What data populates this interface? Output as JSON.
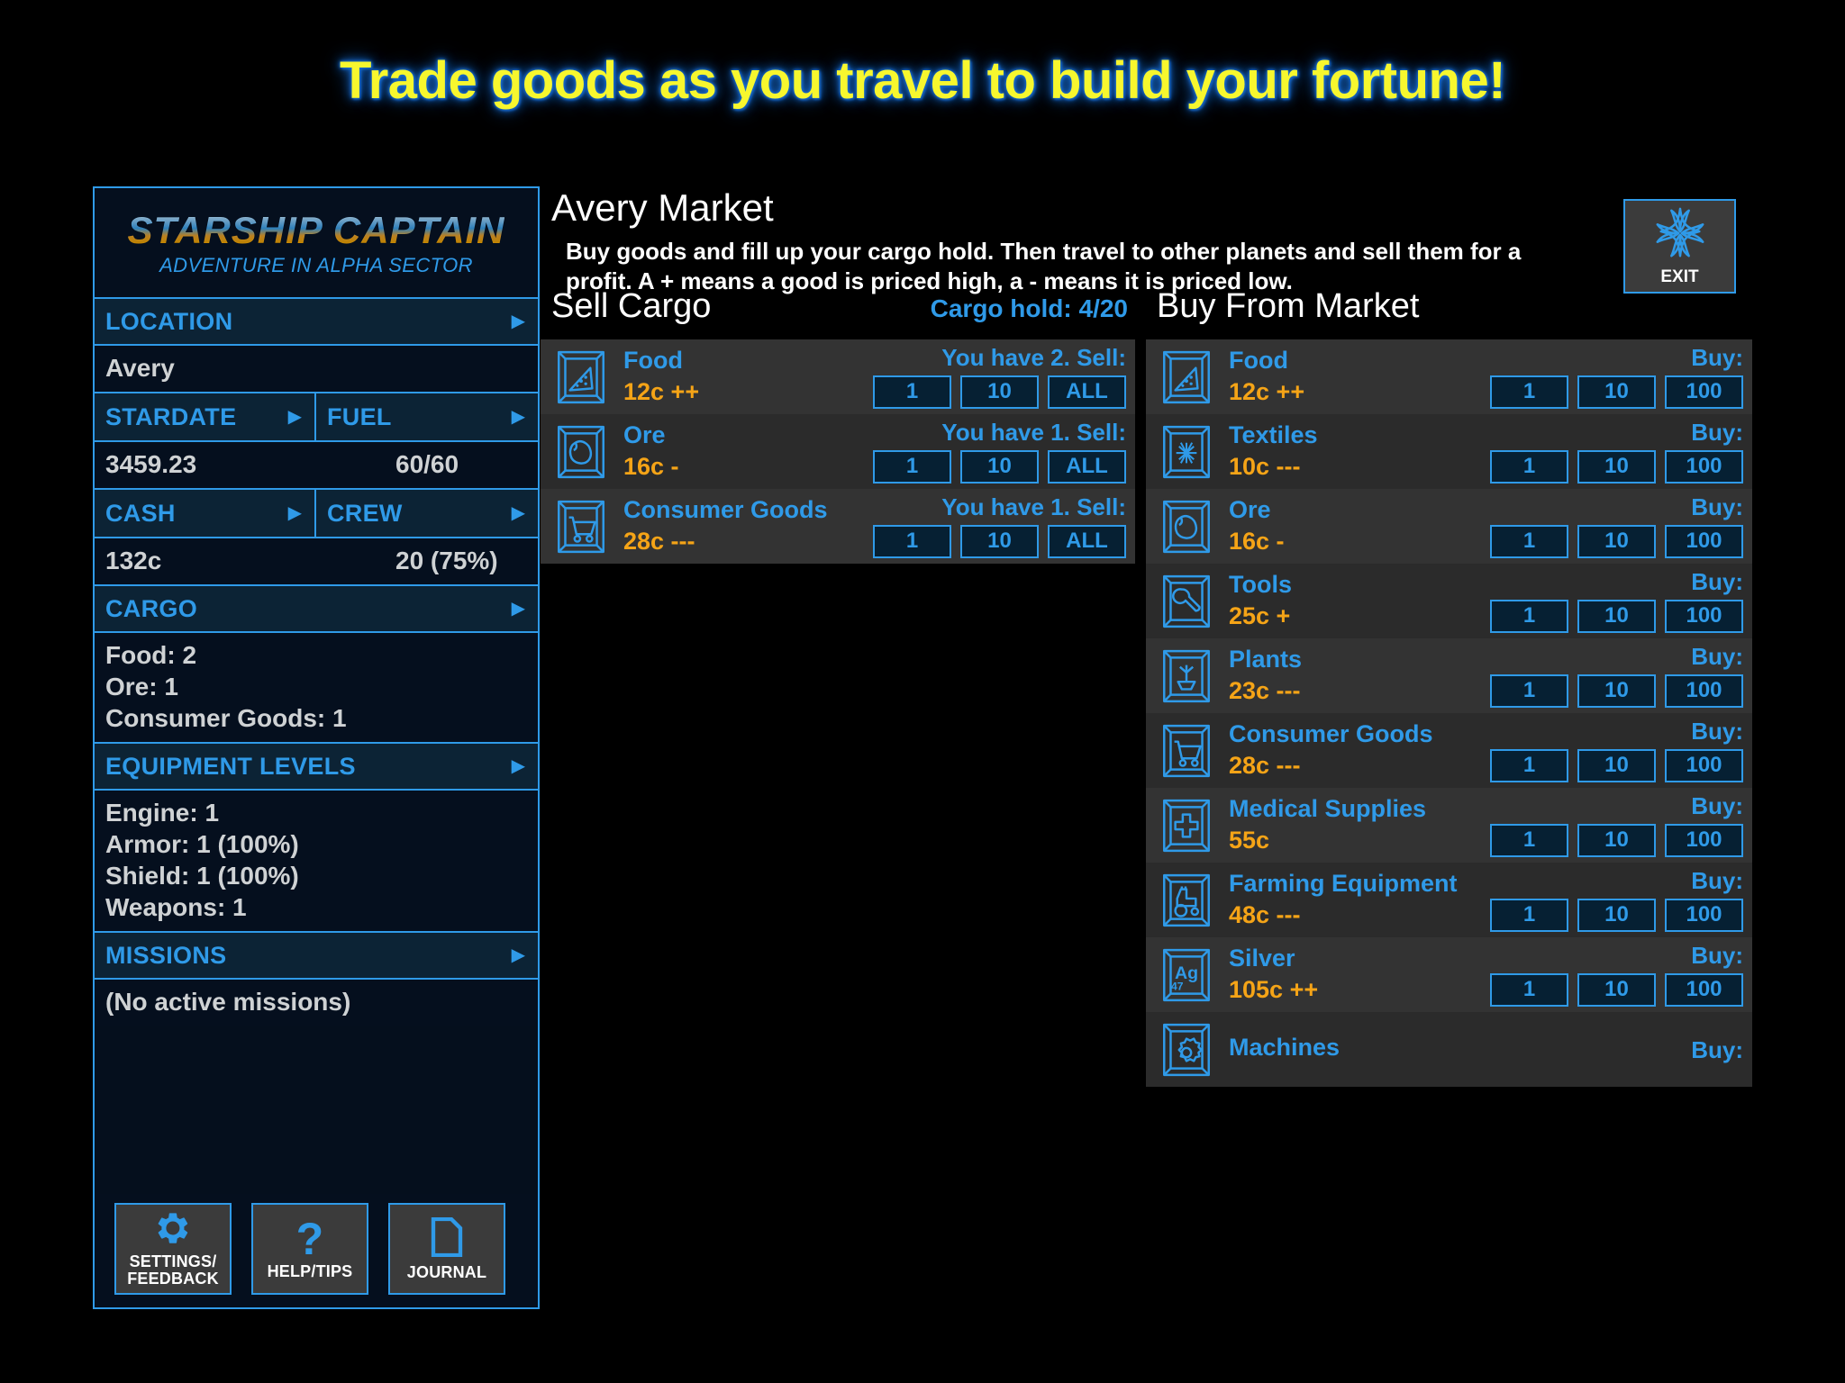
{
  "banner": {
    "text": "Trade goods as you travel to build your fortune!"
  },
  "sidebar": {
    "logo_main": "STARSHIP CAPTAIN",
    "logo_sub": "ADVENTURE IN ALPHA SECTOR",
    "sections": {
      "location_label": "LOCATION",
      "location_value": "Avery",
      "stardate_label": "STARDATE",
      "stardate_value": "3459.23",
      "fuel_label": "FUEL",
      "fuel_value": "60/60",
      "cash_label": "CASH",
      "cash_value": "132c",
      "crew_label": "CREW",
      "crew_value": "20 (75%)",
      "cargo_label": "CARGO",
      "cargo_lines": [
        "Food: 2",
        "Ore: 1",
        "Consumer Goods: 1"
      ],
      "equipment_label": "EQUIPMENT LEVELS",
      "equipment_lines": [
        "Engine: 1",
        "Armor: 1 (100%)",
        "Shield: 1 (100%)",
        "Weapons: 1"
      ],
      "missions_label": "MISSIONS",
      "missions_value": "(No active missions)"
    },
    "buttons": [
      {
        "icon": "gear-icon",
        "label_line1": "SETTINGS/",
        "label_line2": "FEEDBACK"
      },
      {
        "icon": "question-mark-icon",
        "label_line1": "HELP/TIPS",
        "label_line2": ""
      },
      {
        "icon": "journal-page-icon",
        "label_line1": "JOURNAL",
        "label_line2": ""
      }
    ],
    "arrow_glyph": "▶"
  },
  "main": {
    "title": "Avery Market",
    "description": "Buy goods and fill up your cargo hold. Then travel to other planets and sell them for a profit. A + means a good is priced high, a - means it is priced low.",
    "exit": {
      "label": "EXIT",
      "icon": "four-point-star-icon"
    },
    "sell": {
      "heading": "Sell Cargo",
      "cargo_hold": "Cargo hold: 4/20",
      "items": [
        {
          "name": "Food",
          "icon": "food-pizza-icon",
          "price": "12c ++",
          "have": "You have 2. Sell:",
          "qty": [
            "1",
            "10",
            "ALL"
          ]
        },
        {
          "name": "Ore",
          "icon": "ore-rock-icon",
          "price": "16c -",
          "have": "You have 1. Sell:",
          "qty": [
            "1",
            "10",
            "ALL"
          ]
        },
        {
          "name": "Consumer Goods",
          "icon": "shopping-cart-icon",
          "price": "28c ---",
          "have": "You have 1. Sell:",
          "qty": [
            "1",
            "10",
            "ALL"
          ]
        }
      ]
    },
    "buy": {
      "heading": "Buy From Market",
      "buy_label": "Buy:",
      "items": [
        {
          "name": "Food",
          "icon": "food-pizza-icon",
          "price": "12c ++",
          "qty": [
            "1",
            "10",
            "100"
          ]
        },
        {
          "name": "Textiles",
          "icon": "textile-weave-icon",
          "price": "10c ---",
          "qty": [
            "1",
            "10",
            "100"
          ]
        },
        {
          "name": "Ore",
          "icon": "ore-rock-icon",
          "price": "16c -",
          "qty": [
            "1",
            "10",
            "100"
          ]
        },
        {
          "name": "Tools",
          "icon": "wrench-icon",
          "price": "25c +",
          "qty": [
            "1",
            "10",
            "100"
          ]
        },
        {
          "name": "Plants",
          "icon": "seedling-icon",
          "price": "23c ---",
          "qty": [
            "1",
            "10",
            "100"
          ]
        },
        {
          "name": "Consumer Goods",
          "icon": "shopping-cart-icon",
          "price": "28c ---",
          "qty": [
            "1",
            "10",
            "100"
          ]
        },
        {
          "name": "Medical Supplies",
          "icon": "medical-cross-icon",
          "price": "55c",
          "qty": [
            "1",
            "10",
            "100"
          ]
        },
        {
          "name": "Farming Equipment",
          "icon": "tractor-icon",
          "price": "48c ---",
          "qty": [
            "1",
            "10",
            "100"
          ]
        },
        {
          "name": "Silver",
          "icon": "silver-element-icon",
          "price": "105c ++",
          "qty": [
            "1",
            "10",
            "100"
          ]
        },
        {
          "name": "Machines",
          "icon": "gear-machine-icon",
          "price": "",
          "qty": []
        }
      ]
    }
  },
  "colors": {
    "accent_blue": "#2f9ae8",
    "price_orange": "#f5a417",
    "banner_yellow": "#f7f72e",
    "banner_glow": "#1a6fd4",
    "panel_dark": "#050f1e",
    "row_a": "#333333",
    "row_b": "#2b2b2b"
  }
}
